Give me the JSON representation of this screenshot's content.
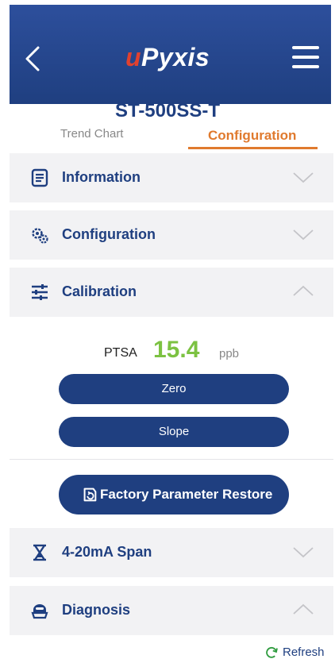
{
  "header": {
    "logo_prefix": "u",
    "logo_rest": "Pyxis"
  },
  "device": {
    "title": "ST-500SS-T"
  },
  "tabs": [
    {
      "label": "Trend Chart",
      "active": false
    },
    {
      "label": "Configuration",
      "active": true
    }
  ],
  "sections": [
    {
      "label": "Information",
      "icon": "document-icon",
      "expanded": false
    },
    {
      "label": "Configuration",
      "icon": "gears-icon",
      "expanded": false
    },
    {
      "label": "Calibration",
      "icon": "sliders-icon",
      "expanded": true
    },
    {
      "label": "4-20mA Span",
      "icon": "hourglass-icon",
      "expanded": false
    },
    {
      "label": "Diagnosis",
      "icon": "diagnosis-icon",
      "expanded": true
    }
  ],
  "calibration": {
    "parameter": "PTSA",
    "value": "15.4",
    "unit": "ppb",
    "zero_label": "Zero",
    "slope_label": "Slope",
    "restore_label": "Factory Parameter Restore"
  },
  "footer": {
    "refresh_label": "Refresh"
  },
  "colors": {
    "primary": "#1f3f80",
    "accent": "#e07a2e",
    "value": "#7cc242",
    "logo_red": "#e0412f"
  }
}
